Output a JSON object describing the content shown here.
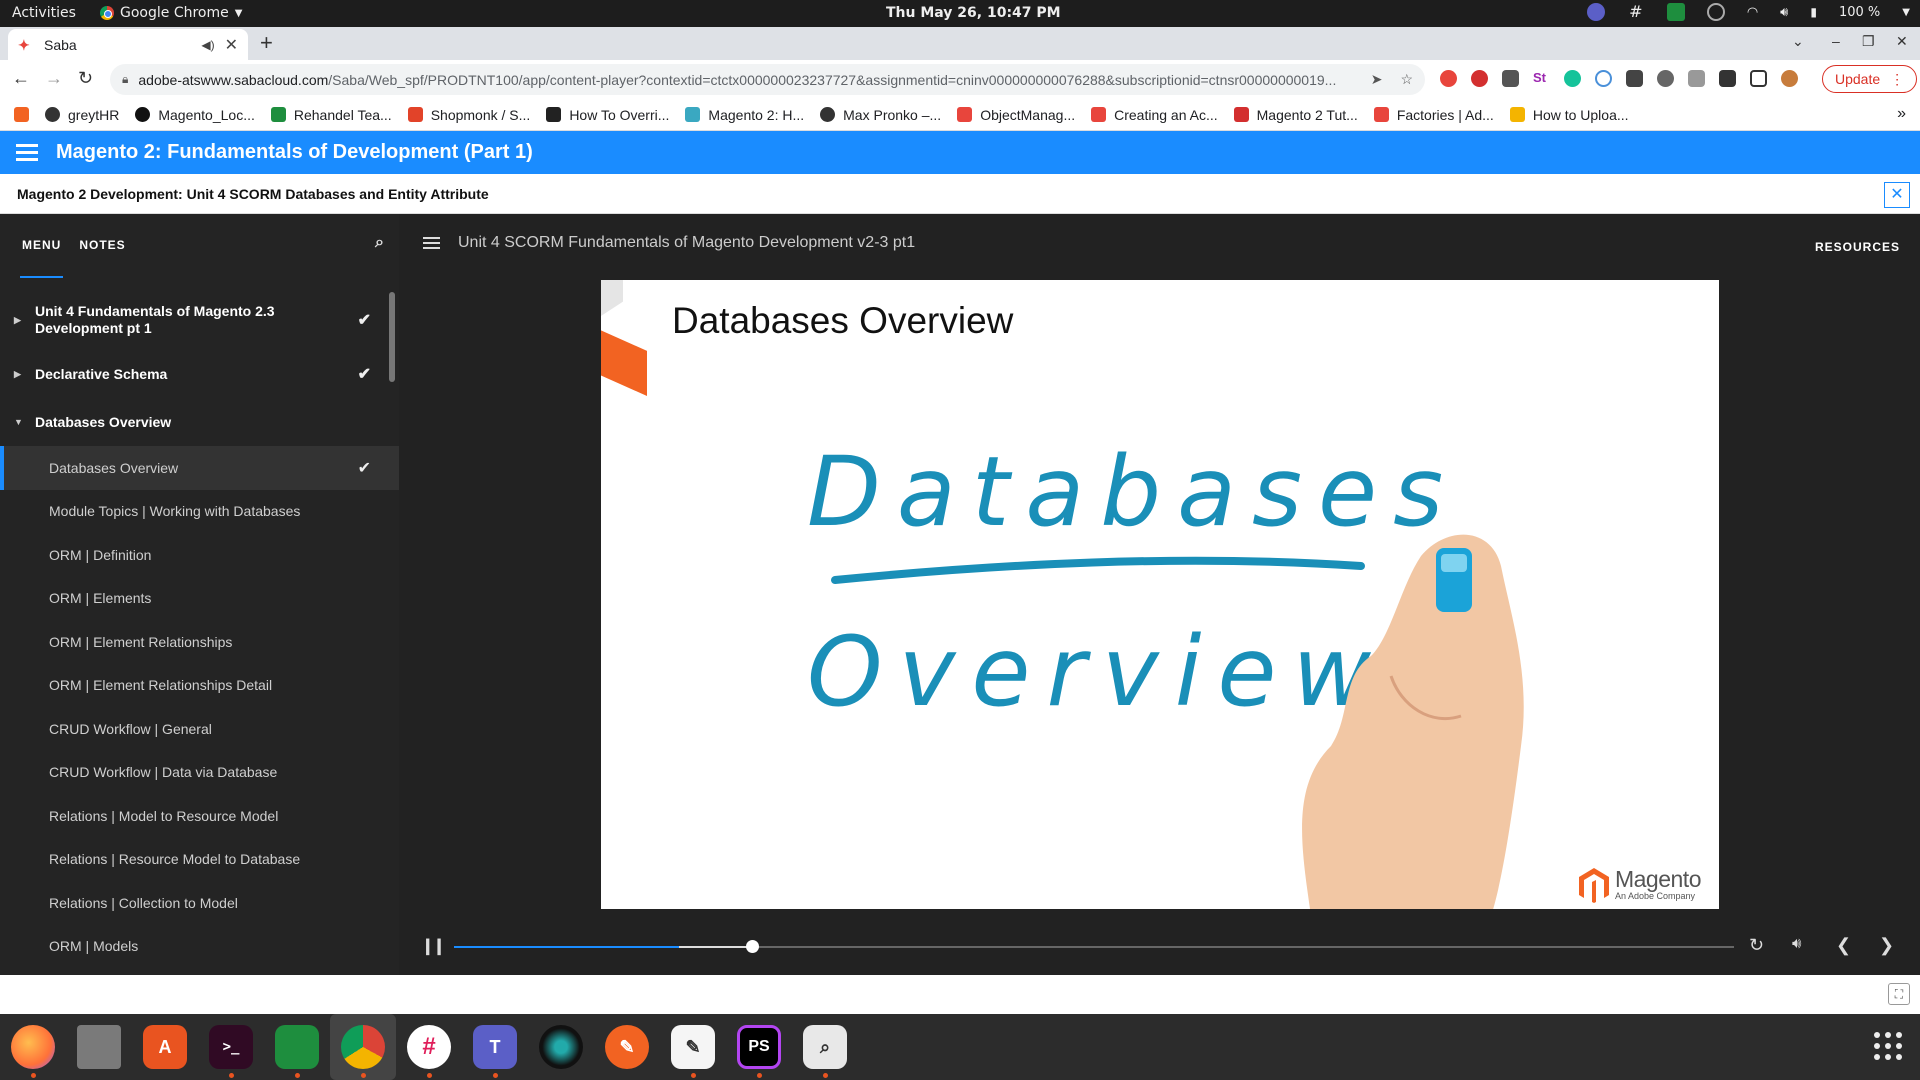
{
  "system": {
    "activities": "Activities",
    "app_name": "Google Chrome",
    "clock": "Thu May 26, 10:47 PM",
    "battery": "100 %"
  },
  "browser": {
    "tab_title": "Saba",
    "url_host": "adobe-atswww.sabacloud.com",
    "url_path": "/Saba/Web_spf/PRODTNT100/app/content-player?contextid=ctctx000000023237727&assignmentid=cninv000000000076288&subscriptionid=ctnsr00000000019...",
    "update_label": "Update",
    "bookmarks": [
      {
        "label": "greytHR",
        "color": "#333"
      },
      {
        "label": "Magento_Loc...",
        "color": "#111"
      },
      {
        "label": "Rehandel Tea...",
        "color": "#1e8e3e"
      },
      {
        "label": "Shopmonk / S...",
        "color": "#e24329"
      },
      {
        "label": "How To Overri...",
        "color": "#222"
      },
      {
        "label": "Magento 2: H...",
        "color": "#3aa8c1"
      },
      {
        "label": "Max Pronko –...",
        "color": "#333"
      },
      {
        "label": "ObjectManag...",
        "color": "#e8453c"
      },
      {
        "label": "Creating an Ac...",
        "color": "#e8453c"
      },
      {
        "label": "Magento 2 Tut...",
        "color": "#d32f2f"
      },
      {
        "label": "Factories | Ad...",
        "color": "#e8453c"
      },
      {
        "label": "How to Uploa...",
        "color": "#f4b400"
      }
    ]
  },
  "saba": {
    "course_title": "Magento 2: Fundamentals of Development (Part 1)",
    "unit_title": "Magento 2 Development: Unit 4 SCORM Databases and Entity Attribute",
    "close_glyph": "✕"
  },
  "sidebar": {
    "tab_menu": "MENU",
    "tab_notes": "NOTES",
    "sections": [
      {
        "label_line1": "Unit 4 Fundamentals of Magento 2.3",
        "label_line2": "Development pt 1",
        "expanded": false,
        "completed": true
      },
      {
        "label": "Declarative Schema",
        "expanded": false,
        "completed": true
      },
      {
        "label": "Databases Overview",
        "expanded": true,
        "completed": false
      }
    ],
    "items": [
      {
        "label": "Databases Overview",
        "active": true,
        "completed": true
      },
      {
        "label": "Module Topics | Working with Databases"
      },
      {
        "label": "ORM | Definition"
      },
      {
        "label": "ORM | Elements"
      },
      {
        "label": "ORM | Element Relationships"
      },
      {
        "label": "ORM | Element Relationships Detail"
      },
      {
        "label": "CRUD Workflow | General"
      },
      {
        "label": "CRUD Workflow | Data via Database"
      },
      {
        "label": "Relations | Model to Resource Model"
      },
      {
        "label": "Relations | Resource Model to Database"
      },
      {
        "label": "Relations | Collection to Model"
      },
      {
        "label": "ORM | Models"
      }
    ]
  },
  "main": {
    "lesson_title": "Unit 4 SCORM Fundamentals of Magento Development v2-3 pt1",
    "resources_label": "RESOURCES",
    "slide": {
      "title": "Databases Overview",
      "word1": "Databases",
      "word2": "Overview",
      "brand_name": "Magento",
      "brand_sub": "An Adobe Company",
      "accent_color": "#f26322",
      "ink_color": "#1a8fb8"
    },
    "player": {
      "played_fraction": 0.233,
      "buffered_fraction": 0.176
    }
  },
  "dock": {
    "apps": [
      "firefox-icon",
      "files-icon",
      "software-icon",
      "terminal-icon",
      "google-chat-icon",
      "chrome-icon",
      "slack-icon",
      "teams-icon",
      "camera-icon",
      "inkscape-icon",
      "text-editor-icon",
      "phpstorm-icon",
      "image-viewer-icon"
    ]
  }
}
